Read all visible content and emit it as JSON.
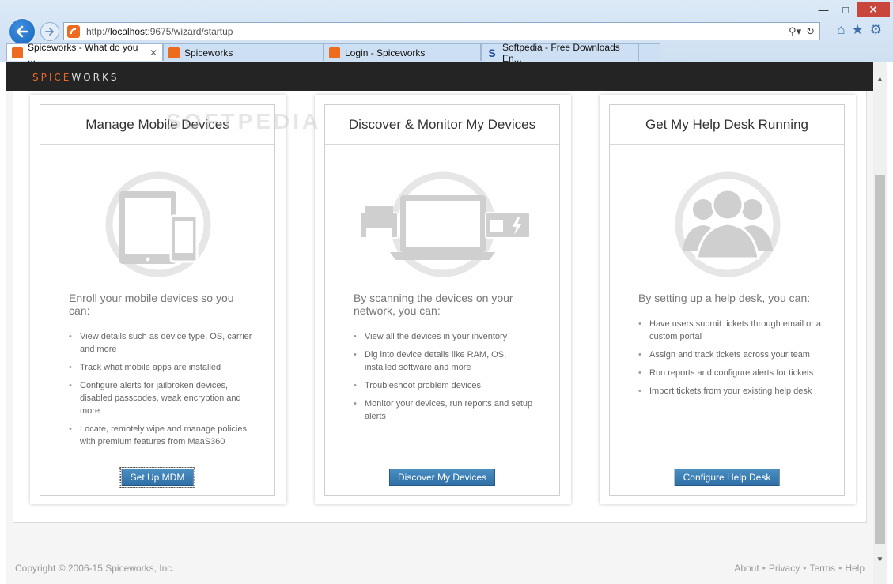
{
  "browser": {
    "url_prefix": "http://",
    "url_host": "localhost",
    "url_rest": ":9675/wizard/startup",
    "tabs": [
      {
        "label": "Spiceworks - What do you ...",
        "icon": "spiceworks-icon",
        "active": true
      },
      {
        "label": "Spiceworks",
        "icon": "spiceworks-icon",
        "active": false
      },
      {
        "label": "Login - Spiceworks",
        "icon": "spiceworks-icon",
        "active": false
      },
      {
        "label": "Softpedia - Free Downloads En...",
        "icon": "softpedia-icon",
        "active": false
      }
    ]
  },
  "app": {
    "logo_a": "SPICE",
    "logo_b": "WORKS"
  },
  "watermark": "SOFTPEDIA",
  "cards": [
    {
      "title": "Manage Mobile Devices",
      "icon": "mobile-devices-icon",
      "description": "Enroll your mobile devices so you can:",
      "items": [
        "View details such as device type, OS, carrier and more",
        "Track what mobile apps are installed",
        "Configure alerts for jailbroken devices, disabled passcodes, weak encryption and more",
        "Locate, remotely wipe and manage policies with premium features from MaaS360"
      ],
      "button": "Set Up MDM"
    },
    {
      "title": "Discover & Monitor My Devices",
      "icon": "network-devices-icon",
      "description": "By scanning the devices on your network, you can:",
      "items": [
        "View all the devices in your inventory",
        "Dig into device details like RAM, OS, installed software and more",
        "Troubleshoot problem devices",
        "Monitor your devices, run reports and setup alerts"
      ],
      "button": "Discover My Devices"
    },
    {
      "title": "Get My Help Desk Running",
      "icon": "help-desk-users-icon",
      "description": "By setting up a help desk, you can:",
      "items": [
        "Have users submit tickets through email or a custom portal",
        "Assign and track tickets across your team",
        "Run reports and configure alerts for tickets",
        "Import tickets from your existing help desk"
      ],
      "button": "Configure Help Desk"
    }
  ],
  "footer": {
    "copyright": "Copyright © 2006-15 Spiceworks, Inc.",
    "links": [
      "About",
      "Privacy",
      "Terms",
      "Help"
    ],
    "separator": "•"
  },
  "colors": {
    "accent": "#e86a2a",
    "button": "#3a7db5",
    "nav_bg": "#242424"
  }
}
